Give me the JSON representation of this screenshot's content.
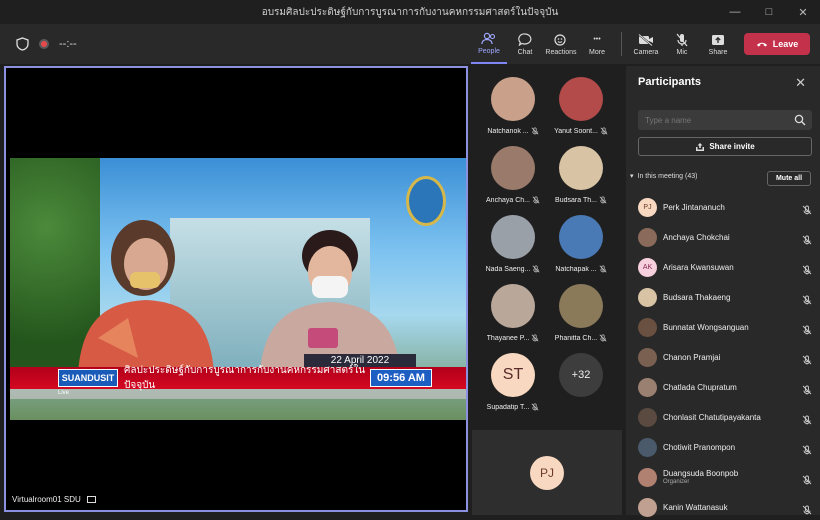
{
  "window": {
    "title": "อบรมศิลปะประดิษฐ์กับการบูรณาการกับงานคหกรรมศาสตร์ในปัจจุบัน"
  },
  "toolbar": {
    "timer": "--:--",
    "people": "People",
    "chat": "Chat",
    "reactions": "Reactions",
    "more": "More",
    "camera": "Camera",
    "mic": "Mic",
    "share": "Share",
    "leave": "Leave"
  },
  "stage": {
    "date": "22 April 2022",
    "channel": "SUANDUSIT",
    "live": "Live",
    "headline": "ศิลปะประดิษฐ์กับการบูรณาการกับงานคหกรรมศาสตร์ในปัจจุบัน",
    "time": "09:56 AM",
    "label": "Virtualroom01 SDU"
  },
  "gallery": [
    {
      "name": "Natchanok ...",
      "color": "#c9a08a"
    },
    {
      "name": "Yanut Soont...",
      "color": "#b44b4b"
    },
    {
      "name": "Anchaya Ch...",
      "color": "#9a7a6a"
    },
    {
      "name": "Budsara Th...",
      "color": "#d8c3a5"
    },
    {
      "name": "Nada Saeng...",
      "color": "#9aa0a8"
    },
    {
      "name": "Natchapak ...",
      "color": "#4a7ab5"
    },
    {
      "name": "Thayanee P...",
      "color": "#b9a79a"
    },
    {
      "name": "Phanitta Ch...",
      "color": "#8a7a5a"
    },
    {
      "name": "Supadatip T...",
      "initials": "ST",
      "color": "#f8d8c0"
    },
    {
      "name": "",
      "initials": "+32",
      "color": "#3d3d3d"
    }
  ],
  "pinned": {
    "initials": "PJ"
  },
  "panel": {
    "title": "Participants",
    "search_placeholder": "Type a name",
    "share_invite": "Share invite",
    "section": "In this meeting (43)",
    "mute_all": "Mute all",
    "participants": [
      {
        "name": "Perk Jintananuch",
        "initials": "PJ",
        "color": "#f8d8c0",
        "role": ""
      },
      {
        "name": "Anchaya Chokchai",
        "initials": "",
        "color": "#8a6a5a",
        "role": ""
      },
      {
        "name": "Arisara Kwansuwan",
        "initials": "AK",
        "color": "#f6d0dc",
        "role": ""
      },
      {
        "name": "Budsara Thakaeng",
        "initials": "",
        "color": "#d8c3a5",
        "role": ""
      },
      {
        "name": "Bunnatat Wongsanguan",
        "initials": "",
        "color": "#6a5040",
        "role": ""
      },
      {
        "name": "Chanon Pramjai",
        "initials": "",
        "color": "#7a6050",
        "role": ""
      },
      {
        "name": "Chatlada Chupratum",
        "initials": "",
        "color": "#9a8070",
        "role": ""
      },
      {
        "name": "Chonlasit Chatutipayakanta",
        "initials": "",
        "color": "#5a4a40",
        "role": ""
      },
      {
        "name": "Chotiwit Pranompon",
        "initials": "",
        "color": "#4a5a6a",
        "role": ""
      },
      {
        "name": "Duangsuda Boonpob",
        "initials": "",
        "color": "#b08070",
        "role": "Organizer"
      },
      {
        "name": "Kanin Wattanasuk",
        "initials": "",
        "color": "#c0a090",
        "role": ""
      }
    ]
  }
}
